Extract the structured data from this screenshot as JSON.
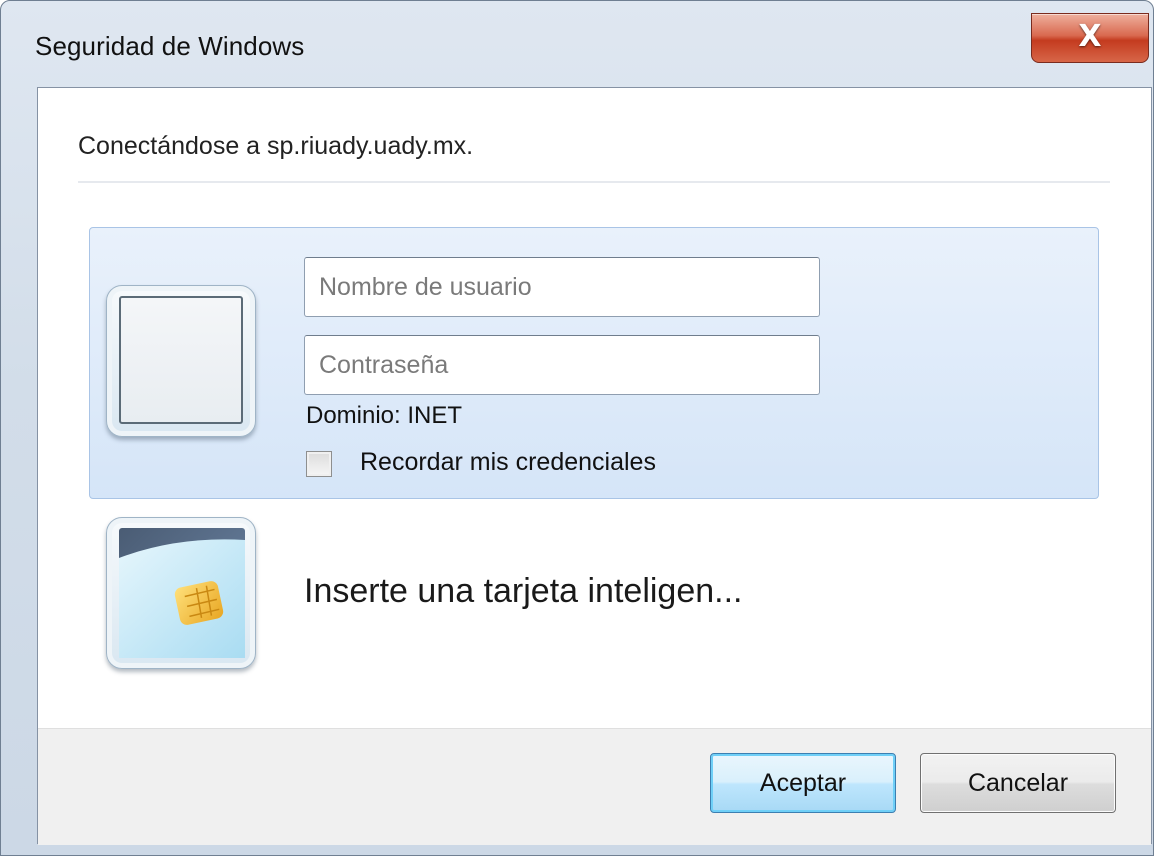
{
  "window": {
    "title": "Seguridad de Windows",
    "close_label": "X"
  },
  "dialog": {
    "heading": "Conectándose a sp.riuady.uady.mx.",
    "credentials": {
      "username_placeholder": "Nombre de usuario",
      "username_value": "",
      "password_placeholder": "Contraseña",
      "password_value": "",
      "domain_label": "Dominio: INET",
      "remember_label": "Recordar mis credenciales",
      "remember_checked": false
    },
    "smartcard": {
      "label": "Inserte una tarjeta inteligen..."
    }
  },
  "footer": {
    "ok_label": "Aceptar",
    "cancel_label": "Cancelar"
  },
  "colors": {
    "accent": "#3c7fb1",
    "selected_tile": "#d5e5f8",
    "close_button": "#c43b1f"
  },
  "icons": {
    "close": "close-icon",
    "user_tile": "user-tile-icon",
    "smartcard": "smartcard-icon"
  }
}
